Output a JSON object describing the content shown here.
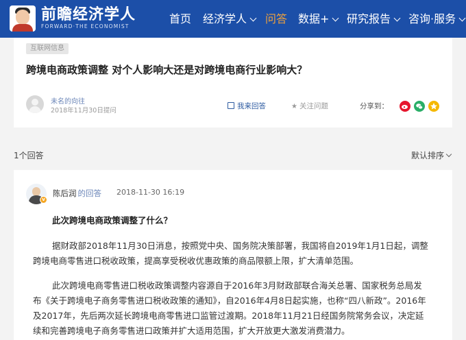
{
  "header": {
    "logo_cn": "前瞻经济学人",
    "logo_en": "FORWARD·THE ECONOMIST",
    "nav": [
      {
        "label": "首页",
        "active": false,
        "dropdown": false
      },
      {
        "label": "经济学人",
        "active": false,
        "dropdown": true
      },
      {
        "label": "问答",
        "active": true,
        "dropdown": false
      },
      {
        "label": "数据+",
        "active": false,
        "dropdown": true
      },
      {
        "label": "研究报告",
        "active": false,
        "dropdown": true
      },
      {
        "label": "咨询·服务",
        "active": false,
        "dropdown": true
      }
    ]
  },
  "question": {
    "tag": "互联网信息",
    "title": "跨境电商政策调整 对个人影响大还是对跨境电商行业影响大？",
    "asker_name": "未名的向往",
    "asked_time": "2018年11月30日提问",
    "answer_label": "我来回答",
    "follow_label": "关注问题",
    "share_label": "分享到："
  },
  "share_icons": [
    {
      "name": "weibo-icon",
      "color": "#e6162d"
    },
    {
      "name": "wechat-icon",
      "color": "#2aae67"
    },
    {
      "name": "qzone-icon",
      "color": "#f5b800"
    }
  ],
  "answers_header": {
    "count": "1个回答",
    "sort": "默认排序"
  },
  "answer": {
    "author": "陈后润",
    "role": "的回答",
    "time": "2018-11-30 16:19",
    "badge": "v",
    "heading": "此次跨境电商政策调整了什么？",
    "p1_line1": "据财政部2018年11月30日消息，按照党中央、国务院决策部署，我国将自2019年1月1日起，调整",
    "p1_line2": "跨境电商零售进口税收政策，提高享受税收优惠政策的商品限额上限，扩大清单范围。",
    "p2_line1": "此次跨境电商零售进口税收政策调整内容源自于2016年3月财政部联合海关总署、国家税务总局发",
    "p2_line2": "布《关于跨境电子商务零售进口税收政策的通知》，自2016年4月8日起实施，也称“四八新政”。2016年",
    "p2_line3": "及2017年，先后两次延长跨境电商零售进口监管过渡期。2018年11月21日经国务院常务会议，决定延",
    "p2_line4": "续和完善跨境电子商务零售进口政策并扩大适用范围，扩大开放更大激发消费潜力。"
  },
  "colors": {
    "header_bg": "#1c4fa8",
    "active_nav": "#f0a23c",
    "link": "#6b86b8"
  }
}
